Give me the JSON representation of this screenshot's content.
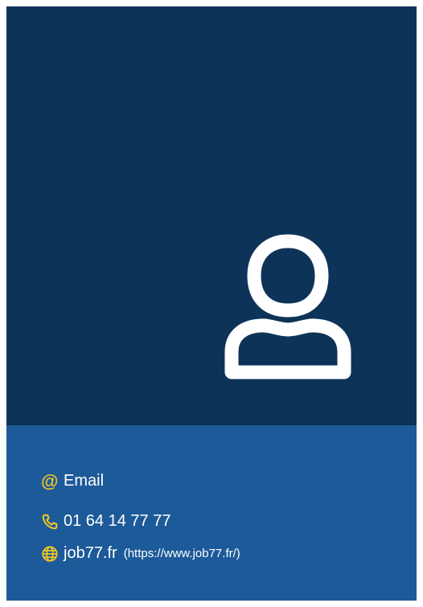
{
  "contact": {
    "email_label": "Email",
    "phone": "01 64 14 77 77",
    "website_label": "job77.fr",
    "website_url": "(https://www.job77.fr/)"
  },
  "icons": {
    "avatar": "user-outline-icon",
    "email": "at-sign-icon",
    "phone": "phone-icon",
    "website": "globe-icon"
  },
  "colors": {
    "top_panel": "#0e3358",
    "bottom_panel": "#1d5a99",
    "accent": "#f2c623",
    "text": "#ffffff"
  }
}
